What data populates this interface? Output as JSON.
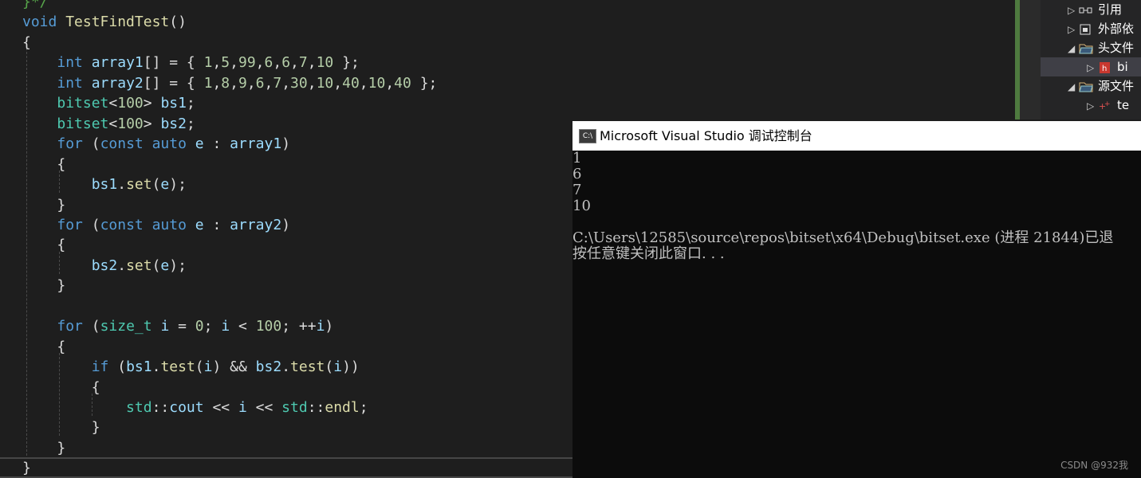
{
  "editor": {
    "lines": [
      [
        {
          "t": "}*/",
          "c": "cm"
        }
      ],
      [
        {
          "t": "void",
          "c": "kw"
        },
        {
          "t": " ",
          "c": "pl"
        },
        {
          "t": "TestFindTest",
          "c": "fn"
        },
        {
          "t": "()",
          "c": "pl"
        }
      ],
      [
        {
          "t": "{",
          "c": "pl"
        }
      ],
      [
        {
          "t": "    ",
          "c": "pl"
        },
        {
          "t": "int",
          "c": "kw"
        },
        {
          "t": " ",
          "c": "pl"
        },
        {
          "t": "array1",
          "c": "id"
        },
        {
          "t": "[] = { ",
          "c": "pl"
        },
        {
          "t": "1",
          "c": "num"
        },
        {
          "t": ",",
          "c": "pl"
        },
        {
          "t": "5",
          "c": "num"
        },
        {
          "t": ",",
          "c": "pl"
        },
        {
          "t": "99",
          "c": "num"
        },
        {
          "t": ",",
          "c": "pl"
        },
        {
          "t": "6",
          "c": "num"
        },
        {
          "t": ",",
          "c": "pl"
        },
        {
          "t": "6",
          "c": "num"
        },
        {
          "t": ",",
          "c": "pl"
        },
        {
          "t": "7",
          "c": "num"
        },
        {
          "t": ",",
          "c": "pl"
        },
        {
          "t": "10",
          "c": "num"
        },
        {
          "t": " };",
          "c": "pl"
        }
      ],
      [
        {
          "t": "    ",
          "c": "pl"
        },
        {
          "t": "int",
          "c": "kw"
        },
        {
          "t": " ",
          "c": "pl"
        },
        {
          "t": "array2",
          "c": "id"
        },
        {
          "t": "[] = { ",
          "c": "pl"
        },
        {
          "t": "1",
          "c": "num"
        },
        {
          "t": ",",
          "c": "pl"
        },
        {
          "t": "8",
          "c": "num"
        },
        {
          "t": ",",
          "c": "pl"
        },
        {
          "t": "9",
          "c": "num"
        },
        {
          "t": ",",
          "c": "pl"
        },
        {
          "t": "6",
          "c": "num"
        },
        {
          "t": ",",
          "c": "pl"
        },
        {
          "t": "7",
          "c": "num"
        },
        {
          "t": ",",
          "c": "pl"
        },
        {
          "t": "30",
          "c": "num"
        },
        {
          "t": ",",
          "c": "pl"
        },
        {
          "t": "10",
          "c": "num"
        },
        {
          "t": ",",
          "c": "pl"
        },
        {
          "t": "40",
          "c": "num"
        },
        {
          "t": ",",
          "c": "pl"
        },
        {
          "t": "10",
          "c": "num"
        },
        {
          "t": ",",
          "c": "pl"
        },
        {
          "t": "40",
          "c": "num"
        },
        {
          "t": " };",
          "c": "pl"
        }
      ],
      [
        {
          "t": "    ",
          "c": "pl"
        },
        {
          "t": "bitset",
          "c": "ty"
        },
        {
          "t": "<",
          "c": "pl"
        },
        {
          "t": "100",
          "c": "num"
        },
        {
          "t": "> ",
          "c": "pl"
        },
        {
          "t": "bs1",
          "c": "id"
        },
        {
          "t": ";",
          "c": "pl"
        }
      ],
      [
        {
          "t": "    ",
          "c": "pl"
        },
        {
          "t": "bitset",
          "c": "ty"
        },
        {
          "t": "<",
          "c": "pl"
        },
        {
          "t": "100",
          "c": "num"
        },
        {
          "t": "> ",
          "c": "pl"
        },
        {
          "t": "bs2",
          "c": "id"
        },
        {
          "t": ";",
          "c": "pl"
        }
      ],
      [
        {
          "t": "    ",
          "c": "pl"
        },
        {
          "t": "for",
          "c": "kw"
        },
        {
          "t": " (",
          "c": "pl"
        },
        {
          "t": "const",
          "c": "kw"
        },
        {
          "t": " ",
          "c": "pl"
        },
        {
          "t": "auto",
          "c": "kw"
        },
        {
          "t": " ",
          "c": "pl"
        },
        {
          "t": "e",
          "c": "id"
        },
        {
          "t": " : ",
          "c": "pl"
        },
        {
          "t": "array1",
          "c": "id"
        },
        {
          "t": ")",
          "c": "pl"
        }
      ],
      [
        {
          "t": "    {",
          "c": "pl"
        }
      ],
      [
        {
          "t": "        ",
          "c": "pl"
        },
        {
          "t": "bs1",
          "c": "id"
        },
        {
          "t": ".",
          "c": "pl"
        },
        {
          "t": "set",
          "c": "fn"
        },
        {
          "t": "(",
          "c": "pl"
        },
        {
          "t": "e",
          "c": "id"
        },
        {
          "t": ");",
          "c": "pl"
        }
      ],
      [
        {
          "t": "    }",
          "c": "pl"
        }
      ],
      [
        {
          "t": "    ",
          "c": "pl"
        },
        {
          "t": "for",
          "c": "kw"
        },
        {
          "t": " (",
          "c": "pl"
        },
        {
          "t": "const",
          "c": "kw"
        },
        {
          "t": " ",
          "c": "pl"
        },
        {
          "t": "auto",
          "c": "kw"
        },
        {
          "t": " ",
          "c": "pl"
        },
        {
          "t": "e",
          "c": "id"
        },
        {
          "t": " : ",
          "c": "pl"
        },
        {
          "t": "array2",
          "c": "id"
        },
        {
          "t": ")",
          "c": "pl"
        }
      ],
      [
        {
          "t": "    {",
          "c": "pl"
        }
      ],
      [
        {
          "t": "        ",
          "c": "pl"
        },
        {
          "t": "bs2",
          "c": "id"
        },
        {
          "t": ".",
          "c": "pl"
        },
        {
          "t": "set",
          "c": "fn"
        },
        {
          "t": "(",
          "c": "pl"
        },
        {
          "t": "e",
          "c": "id"
        },
        {
          "t": ");",
          "c": "pl"
        }
      ],
      [
        {
          "t": "    }",
          "c": "pl"
        }
      ],
      [],
      [
        {
          "t": "    ",
          "c": "pl"
        },
        {
          "t": "for",
          "c": "kw"
        },
        {
          "t": " (",
          "c": "pl"
        },
        {
          "t": "size_t",
          "c": "ty"
        },
        {
          "t": " ",
          "c": "pl"
        },
        {
          "t": "i",
          "c": "id"
        },
        {
          "t": " = ",
          "c": "pl"
        },
        {
          "t": "0",
          "c": "num"
        },
        {
          "t": "; ",
          "c": "pl"
        },
        {
          "t": "i",
          "c": "id"
        },
        {
          "t": " < ",
          "c": "pl"
        },
        {
          "t": "100",
          "c": "num"
        },
        {
          "t": "; ++",
          "c": "pl"
        },
        {
          "t": "i",
          "c": "id"
        },
        {
          "t": ")",
          "c": "pl"
        }
      ],
      [
        {
          "t": "    {",
          "c": "pl"
        }
      ],
      [
        {
          "t": "        ",
          "c": "pl"
        },
        {
          "t": "if",
          "c": "kw"
        },
        {
          "t": " (",
          "c": "pl"
        },
        {
          "t": "bs1",
          "c": "id"
        },
        {
          "t": ".",
          "c": "pl"
        },
        {
          "t": "test",
          "c": "fn"
        },
        {
          "t": "(",
          "c": "pl"
        },
        {
          "t": "i",
          "c": "id"
        },
        {
          "t": ") && ",
          "c": "pl"
        },
        {
          "t": "bs2",
          "c": "id"
        },
        {
          "t": ".",
          "c": "pl"
        },
        {
          "t": "test",
          "c": "fn"
        },
        {
          "t": "(",
          "c": "pl"
        },
        {
          "t": "i",
          "c": "id"
        },
        {
          "t": "))",
          "c": "pl"
        }
      ],
      [
        {
          "t": "        {",
          "c": "pl"
        }
      ],
      [
        {
          "t": "            ",
          "c": "pl"
        },
        {
          "t": "std",
          "c": "ty"
        },
        {
          "t": "::",
          "c": "pl"
        },
        {
          "t": "cout",
          "c": "id"
        },
        {
          "t": " << ",
          "c": "pl"
        },
        {
          "t": "i",
          "c": "id"
        },
        {
          "t": " << ",
          "c": "pl"
        },
        {
          "t": "std",
          "c": "ty"
        },
        {
          "t": "::",
          "c": "pl"
        },
        {
          "t": "endl",
          "c": "fn"
        },
        {
          "t": ";",
          "c": "pl"
        }
      ],
      [
        {
          "t": "        }",
          "c": "pl"
        }
      ],
      [
        {
          "t": "    }",
          "c": "pl"
        }
      ],
      [
        {
          "t": "}",
          "c": "pl"
        }
      ]
    ]
  },
  "solution_explorer": {
    "items": [
      {
        "label": "引用",
        "icon": "references-icon",
        "expand": "collapsed"
      },
      {
        "label": "外部依",
        "icon": "external-deps-icon",
        "expand": "collapsed"
      },
      {
        "label": "头文件",
        "icon": "folder-icon",
        "expand": "expanded"
      },
      {
        "label": "bi",
        "icon": "header-file-icon",
        "expand": "collapsed",
        "selected": true
      },
      {
        "label": "源文件",
        "icon": "folder-icon",
        "expand": "expanded"
      },
      {
        "label": "te",
        "icon": "cpp-file-icon",
        "expand": "collapsed"
      }
    ]
  },
  "console": {
    "icon_text": "C:\\",
    "title": "Microsoft Visual Studio 调试控制台",
    "output": "1\n6\n7\n10\n\nC:\\Users\\12585\\source\\repos\\bitset\\x64\\Debug\\bitset.exe (进程 21844)已退\n按任意键关闭此窗口. . ."
  },
  "watermark": "CSDN @932我",
  "colors": {
    "editor_bg": "#1e1e1e",
    "keyword": "#569cd6",
    "identifier": "#9cdcfe",
    "function": "#dcdcaa",
    "type": "#4ec9b0",
    "number": "#b5cea8",
    "comment": "#57a64a",
    "console_bg": "#0c0c0c"
  }
}
